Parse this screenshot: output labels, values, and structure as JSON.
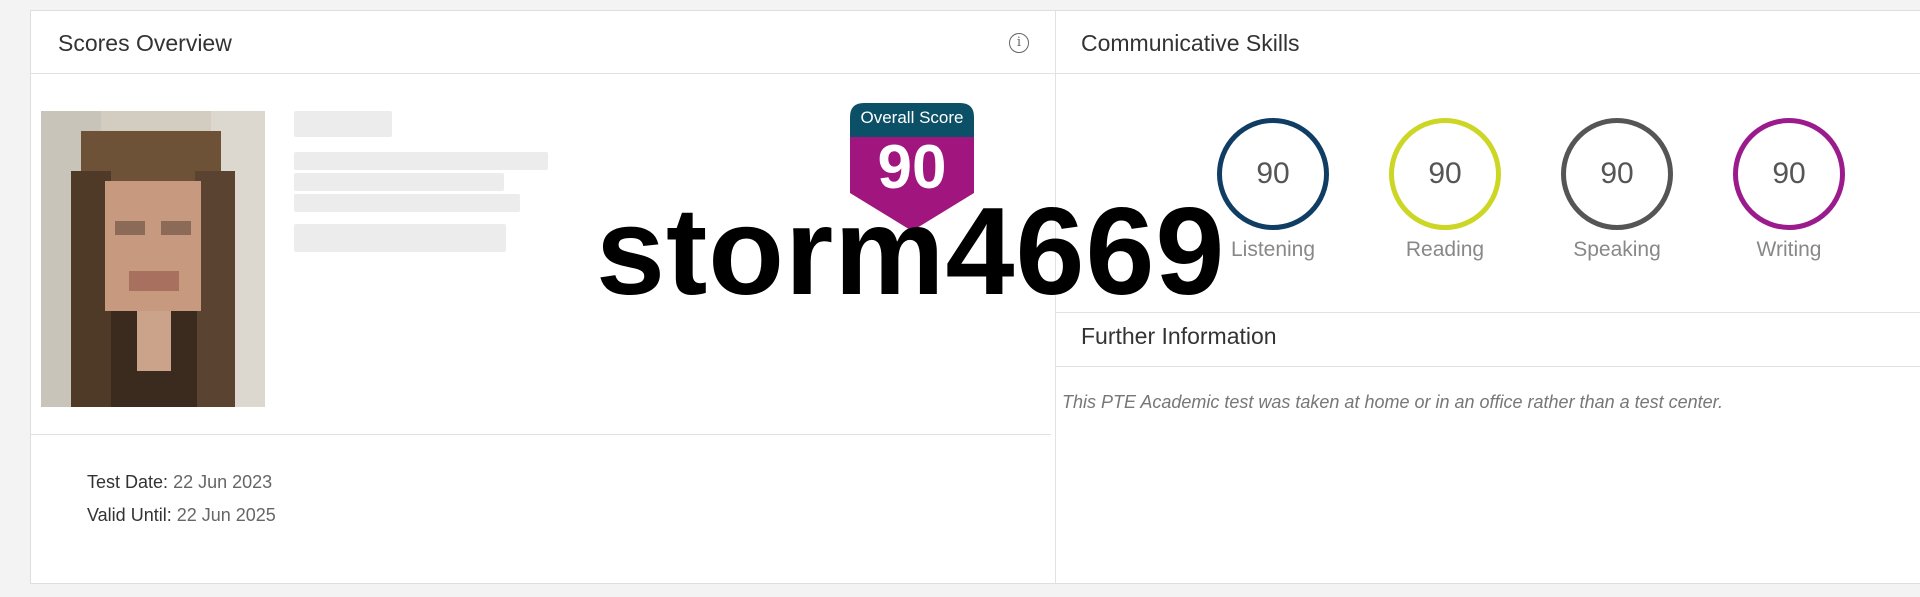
{
  "scores_overview": {
    "title": "Scores Overview",
    "info_icon": "info-circle-icon",
    "overall_score_label": "Overall Score",
    "overall_score": "90",
    "overall_color": "#a0157e",
    "overall_header_color": "#0c5068",
    "test_date_label": "Test Date",
    "test_date": "22 Jun 2023",
    "valid_until_label": "Valid Until",
    "valid_until": "22 Jun 2025"
  },
  "communicative_skills": {
    "title": "Communicative Skills",
    "skills": [
      {
        "name": "Listening",
        "score": "90",
        "color": "#0f3d63"
      },
      {
        "name": "Reading",
        "score": "90",
        "color": "#ccd624"
      },
      {
        "name": "Speaking",
        "score": "90",
        "color": "#555555"
      },
      {
        "name": "Writing",
        "score": "90",
        "color": "#9b1b8d"
      }
    ]
  },
  "further_information": {
    "title": "Further Information",
    "text": "This PTE Academic test was taken at home or in an office rather than a test center."
  },
  "watermark": "storm4669"
}
